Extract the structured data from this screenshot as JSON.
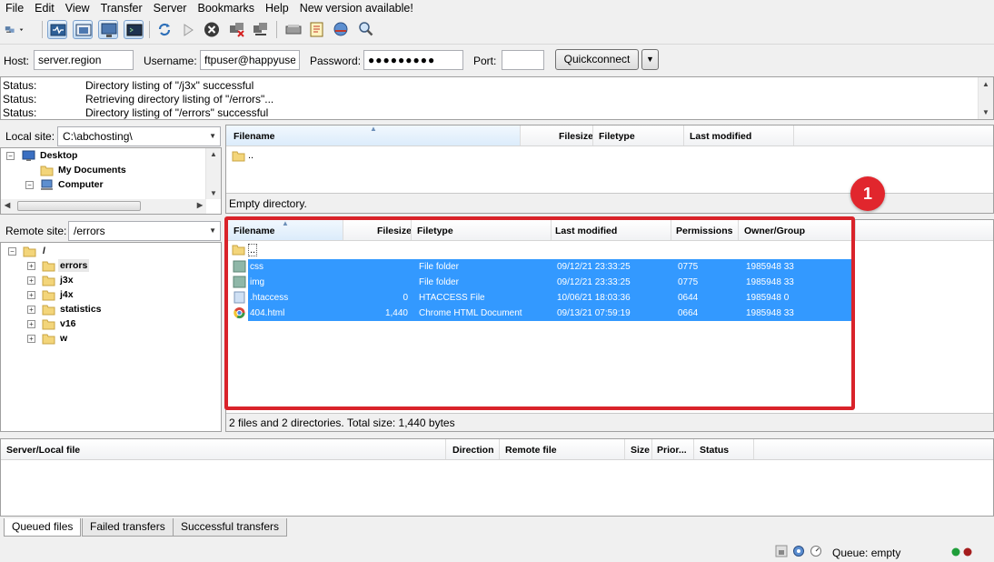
{
  "menu": [
    "File",
    "Edit",
    "View",
    "Transfer",
    "Server",
    "Bookmarks",
    "Help",
    "New version available!"
  ],
  "quickconnect": {
    "host_label": "Host:",
    "host_value": "server.region",
    "username_label": "Username:",
    "username_value": "ftpuser@happyuser",
    "password_label": "Password:",
    "password_value": "●●●●●●●●●",
    "port_label": "Port:",
    "port_value": "",
    "button": "Quickconnect"
  },
  "log": [
    {
      "key": "Status:",
      "msg": "Directory listing of \"/j3x\" successful"
    },
    {
      "key": "Status:",
      "msg": "Retrieving directory listing of \"/errors\"..."
    },
    {
      "key": "Status:",
      "msg": "Directory listing of \"/errors\" successful"
    }
  ],
  "local": {
    "site_label": "Local site:",
    "path": "C:\\abchosting\\",
    "tree": [
      "Desktop",
      "My Documents",
      "Computer"
    ],
    "columns": [
      "Filename",
      "Filesize",
      "Filetype",
      "Last modified"
    ],
    "parent": "..",
    "status": "Empty directory."
  },
  "remote": {
    "site_label": "Remote site:",
    "path": "/errors",
    "tree": [
      "/",
      "errors",
      "j3x",
      "j4x",
      "statistics",
      "v16",
      "w"
    ],
    "columns": [
      "Filename",
      "Filesize",
      "Filetype",
      "Last modified",
      "Permissions",
      "Owner/Group"
    ],
    "parent": "..",
    "files": [
      {
        "name": "css",
        "size": "",
        "type": "File folder",
        "modified": "09/12/21 23:33:25",
        "perms": "0775",
        "owner": "1985948 33"
      },
      {
        "name": "img",
        "size": "",
        "type": "File folder",
        "modified": "09/12/21 23:33:25",
        "perms": "0775",
        "owner": "1985948 33"
      },
      {
        "name": ".htaccess",
        "size": "0",
        "type": "HTACCESS File",
        "modified": "10/06/21 18:03:36",
        "perms": "0644",
        "owner": "1985948 0"
      },
      {
        "name": "404.html",
        "size": "1,440",
        "type": "Chrome HTML Document",
        "modified": "09/13/21 07:59:19",
        "perms": "0664",
        "owner": "1985948 33"
      }
    ],
    "status": "2 files and 2 directories. Total size: 1,440 bytes"
  },
  "queue": {
    "columns": [
      "Server/Local file",
      "Direction",
      "Remote file",
      "Size",
      "Prior...",
      "Status"
    ],
    "tabs": [
      "Queued files",
      "Failed transfers",
      "Successful transfers"
    ],
    "status": "Queue: empty"
  },
  "annotation": {
    "badge": "1",
    "color": "#d9232a"
  },
  "colors": {
    "selection": "#3399ff",
    "highlight": "#d9232a"
  }
}
